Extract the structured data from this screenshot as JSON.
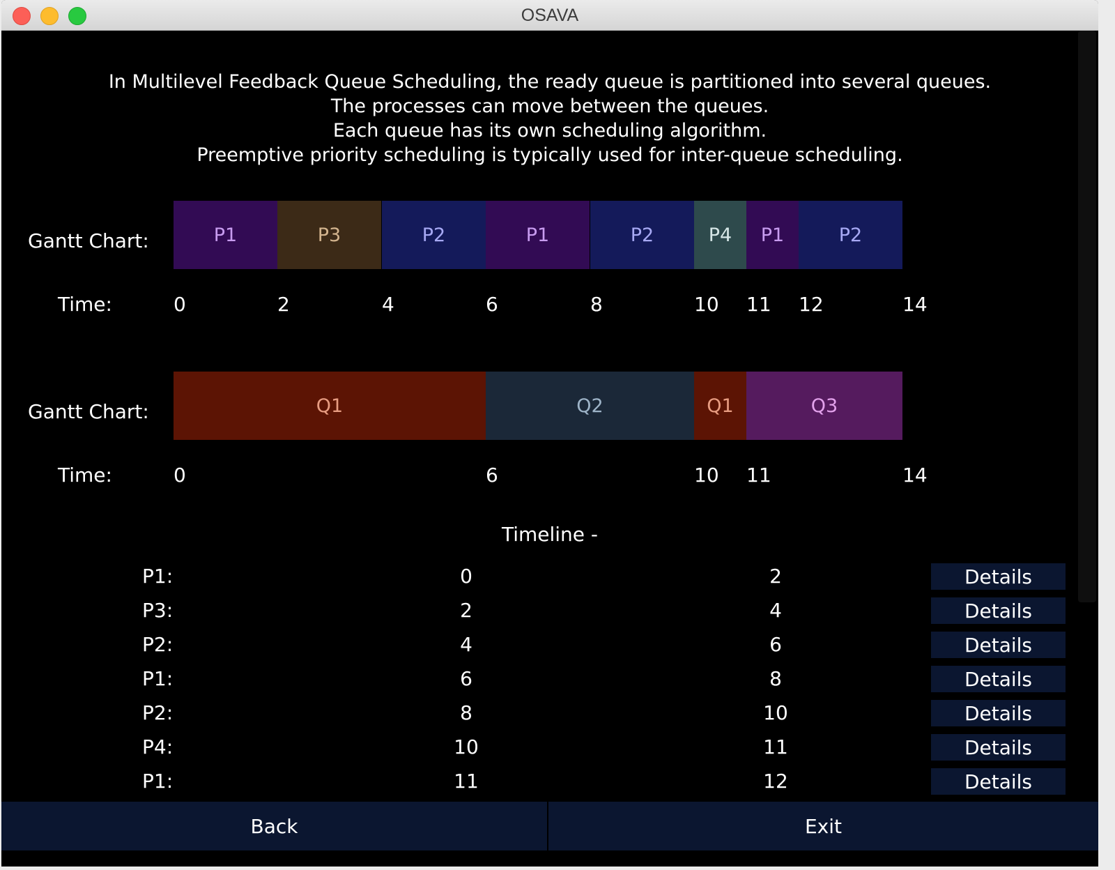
{
  "window": {
    "title": "OSAVA"
  },
  "intro": [
    "In Multilevel Feedback Queue Scheduling, the ready queue is partitioned into several queues.",
    "The processes can move between the queues.",
    "Each queue has its own scheduling algorithm.",
    "Preemptive priority scheduling is typically used for inter-queue scheduling."
  ],
  "process_gantt": {
    "label": "Gantt Chart:",
    "time_label": "Time:",
    "segments": [
      {
        "name": "P1",
        "start": 0,
        "end": 2,
        "bg": "#320b54",
        "fg": "#c89cf0"
      },
      {
        "name": "P3",
        "start": 2,
        "end": 4,
        "bg": "#3c2a17",
        "fg": "#d3b48e"
      },
      {
        "name": "P2",
        "start": 4,
        "end": 6,
        "bg": "#141a5a",
        "fg": "#a7a9f4"
      },
      {
        "name": "P1",
        "start": 6,
        "end": 8,
        "bg": "#320b54",
        "fg": "#c89cf0"
      },
      {
        "name": "P2",
        "start": 8,
        "end": 10,
        "bg": "#141a5a",
        "fg": "#a7a9f4"
      },
      {
        "name": "P4",
        "start": 10,
        "end": 11,
        "bg": "#2e4a4c",
        "fg": "#d6e6e6"
      },
      {
        "name": "P1",
        "start": 11,
        "end": 12,
        "bg": "#320b54",
        "fg": "#c89cf0"
      },
      {
        "name": "P2",
        "start": 12,
        "end": 14,
        "bg": "#141a5a",
        "fg": "#a7a9f4"
      }
    ],
    "ticks": [
      "0",
      "2",
      "4",
      "6",
      "8",
      "10",
      "11",
      "12",
      "14"
    ],
    "tick_values": [
      0,
      2,
      4,
      6,
      8,
      10,
      11,
      12,
      14
    ]
  },
  "queue_gantt": {
    "label": "Gantt Chart:",
    "time_label": "Time:",
    "segments": [
      {
        "name": "Q1",
        "start": 0,
        "end": 6,
        "bg": "#5c1404",
        "fg": "#e89d82"
      },
      {
        "name": "Q2",
        "start": 6,
        "end": 10,
        "bg": "#1b2838",
        "fg": "#9eb4c8"
      },
      {
        "name": "Q1",
        "start": 10,
        "end": 11,
        "bg": "#5c1404",
        "fg": "#e89d82"
      },
      {
        "name": "Q3",
        "start": 11,
        "end": 14,
        "bg": "#551b5e",
        "fg": "#e3a2ec"
      }
    ],
    "ticks": [
      "0",
      "6",
      "10",
      "11",
      "14"
    ],
    "tick_values": [
      0,
      6,
      10,
      11,
      14
    ]
  },
  "timeline": {
    "title": "Timeline -",
    "details_label": "Details",
    "rows": [
      {
        "process": "P1:",
        "start": "0",
        "end": "2"
      },
      {
        "process": "P3:",
        "start": "2",
        "end": "4"
      },
      {
        "process": "P2:",
        "start": "4",
        "end": "6"
      },
      {
        "process": "P1:",
        "start": "6",
        "end": "8"
      },
      {
        "process": "P2:",
        "start": "8",
        "end": "10"
      },
      {
        "process": "P4:",
        "start": "10",
        "end": "11"
      },
      {
        "process": "P1:",
        "start": "11",
        "end": "12"
      }
    ]
  },
  "footer": {
    "back_label": "Back",
    "exit_label": "Exit"
  }
}
